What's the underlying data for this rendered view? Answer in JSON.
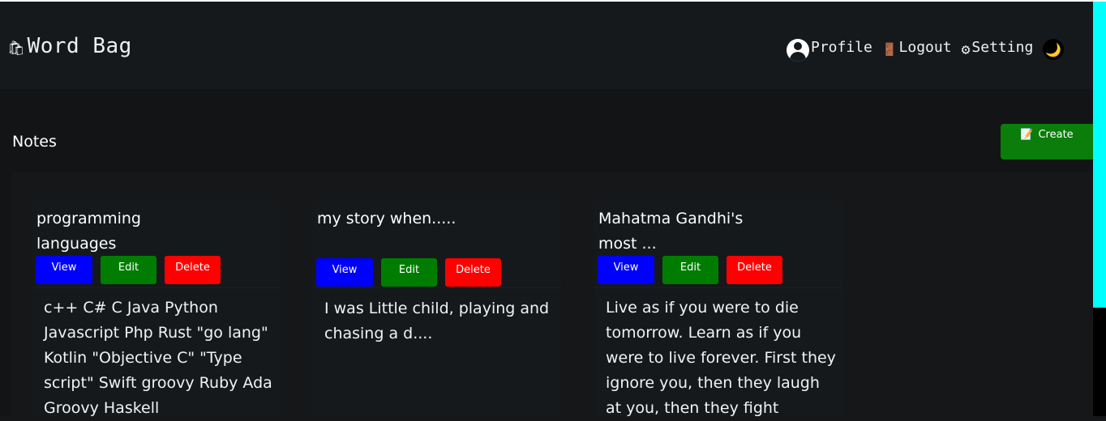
{
  "brand": {
    "icon": "shopping-bags-icon",
    "icon_glyph": "🛍",
    "title": "Word Bag"
  },
  "nav": {
    "profile": {
      "icon": "user-avatar-icon",
      "label": "Profile"
    },
    "logout": {
      "icon": "door-icon",
      "icon_glyph": "🚪",
      "label": "Logout"
    },
    "setting": {
      "icon": "gear-icon",
      "icon_glyph": "⚙",
      "label": "Setting"
    },
    "theme_toggle": {
      "icon": "crescent-moon-icon",
      "icon_glyph": "🌙"
    }
  },
  "notes": {
    "heading": "Notes",
    "create_button": {
      "icon": "memo-icon",
      "icon_glyph": "📝",
      "label": "Create"
    },
    "cards": [
      {
        "title_line1": "programming",
        "title_line2": "languages",
        "body": "c++ C# C Java Python Javascript Php Rust \"go lang\" Kotlin \"Objective C\" \"Type script\" Swift groovy Ruby Ada Groovy Haskell",
        "view": "View",
        "edit": "Edit",
        "delete": "Delete"
      },
      {
        "title_line1": "my story when.....",
        "title_line2": "",
        "body": "I was Little child, playing and chasing a d....",
        "view": "View",
        "edit": "Edit",
        "delete": "Delete"
      },
      {
        "title_line1": "Mahatma Gandhi's",
        "title_line2": "most ...",
        "body": "Live as if you were to die tomorrow. Learn as if you were to live forever. First they ignore you, then they laugh at you, then they fight",
        "view": "View",
        "edit": "Edit",
        "delete": "Delete"
      }
    ]
  },
  "colors": {
    "navbar_bg": "#16191c",
    "page_bg": "#161718",
    "view_button": "#0000ff",
    "edit_button": "#007d00",
    "delete_button": "#ff0000",
    "create_button": "#0a7d0a",
    "scrollbar_thumb": "#00ffff"
  }
}
